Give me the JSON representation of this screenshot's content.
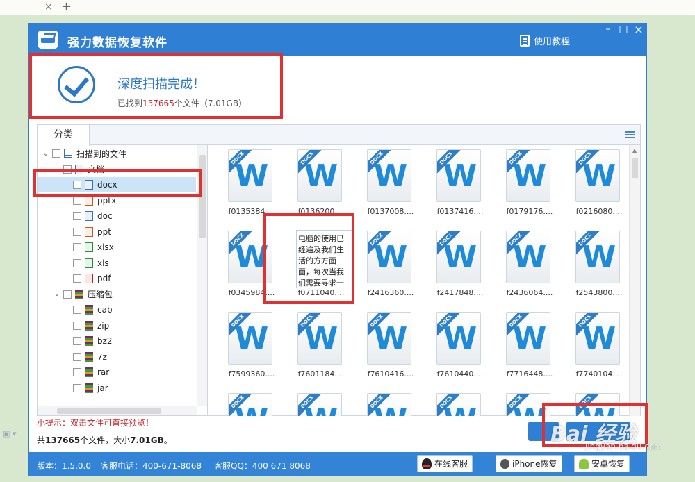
{
  "browser": {
    "close_glyph": "×",
    "new_tab_glyph": "+"
  },
  "window": {
    "title": "强力数据恢复软件",
    "tutorial_label": "使用教程",
    "controls": {
      "minimize": "–",
      "maximize": "□",
      "close": "×"
    }
  },
  "scan": {
    "title": "深度扫描完成！",
    "found_prefix": "已找到",
    "found_count": "137665",
    "found_suffix": "个文件（7.01GB）"
  },
  "panel": {
    "tab_label": "分类"
  },
  "tree": [
    {
      "label": "扫描到的文件",
      "level": 0,
      "icon": "list",
      "expander": "⌄"
    },
    {
      "label": "文档",
      "level": 1,
      "icon": "doc",
      "expander": "⌄"
    },
    {
      "label": "docx",
      "level": 2,
      "icon": "doc",
      "selected": true
    },
    {
      "label": "pptx",
      "level": 2,
      "icon": "ppt"
    },
    {
      "label": "doc",
      "level": 2,
      "icon": "doc"
    },
    {
      "label": "ppt",
      "level": 2,
      "icon": "ppt"
    },
    {
      "label": "xlsx",
      "level": 2,
      "icon": "xls"
    },
    {
      "label": "xls",
      "level": 2,
      "icon": "xls"
    },
    {
      "label": "pdf",
      "level": 2,
      "icon": "pdf"
    },
    {
      "label": "压缩包",
      "level": 1,
      "icon": "zip",
      "expander": "⌄"
    },
    {
      "label": "cab",
      "level": 2,
      "icon": "zip"
    },
    {
      "label": "zip",
      "level": 2,
      "icon": "zip"
    },
    {
      "label": "bz2",
      "level": 2,
      "icon": "zip"
    },
    {
      "label": "7z",
      "level": 2,
      "icon": "zip"
    },
    {
      "label": "rar",
      "level": 2,
      "icon": "zip"
    },
    {
      "label": "jar",
      "level": 2,
      "icon": "zip"
    }
  ],
  "files": [
    {
      "name": "f0135384...."
    },
    {
      "name": "f0136200...."
    },
    {
      "name": "f0137008...."
    },
    {
      "name": "f0137416...."
    },
    {
      "name": "f0179176...."
    },
    {
      "name": "f0216080...."
    },
    {
      "name": "f0345984...."
    },
    {
      "name": "f0711040....",
      "preview": "电脑的使用已经遍及我们生活的方方面面，每次当我们需要寻求一些更精确的解答"
    },
    {
      "name": "f2416360...."
    },
    {
      "name": "f2417848...."
    },
    {
      "name": "f2436064...."
    },
    {
      "name": "f2543800...."
    },
    {
      "name": "f7599360...."
    },
    {
      "name": "f7601184...."
    },
    {
      "name": "f7610416...."
    },
    {
      "name": "f7610440...."
    },
    {
      "name": "f7716448...."
    },
    {
      "name": "f7740104...."
    },
    {
      "name": ""
    },
    {
      "name": ""
    },
    {
      "name": ""
    },
    {
      "name": ""
    },
    {
      "name": ""
    },
    {
      "name": ""
    }
  ],
  "file_badge": "DOCX",
  "file_glyph": "W",
  "tip": "小提示：双击文件可直接预览！",
  "summary": {
    "prefix": "共",
    "count": "137665",
    "middle": "个文件，大小",
    "size": "7.01GB",
    "suffix": "。"
  },
  "footer": {
    "version": "版本：1.5.0.0",
    "phone": "客服电话：400-671-8068",
    "qq": "客服QQ：400 671 8068",
    "online_service": "在线客服",
    "iphone_recovery": "iPhone恢复",
    "android_recovery": "安卓恢复"
  },
  "watermark": {
    "brand": "Bai 经验",
    "url": "jingyan.baidu.com"
  },
  "colors": {
    "accent": "#2f7fd4",
    "annotation": "#e03030",
    "highlight": "#c8232c"
  }
}
